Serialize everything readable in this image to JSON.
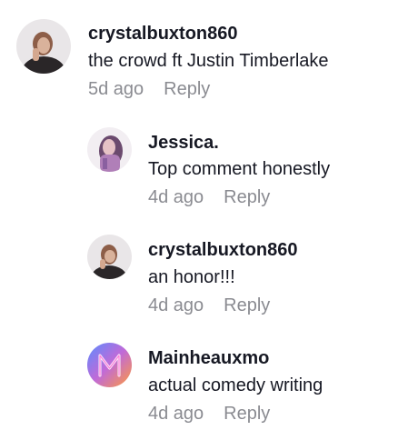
{
  "comment": {
    "username": "crystalbuxton860",
    "text": "the crowd ft Justin Timberlake",
    "time": "5d ago",
    "reply_label": "Reply"
  },
  "replies": [
    {
      "username": "Jessica.",
      "text": "Top comment honestly",
      "time": "4d ago",
      "reply_label": "Reply"
    },
    {
      "username": "crystalbuxton860",
      "text": "an honor!!!",
      "time": "4d ago",
      "reply_label": "Reply"
    },
    {
      "username": "Mainheauxmo",
      "text": "actual comedy writing",
      "time": "4d ago",
      "reply_label": "Reply"
    }
  ],
  "colors": {
    "text_primary": "#161823",
    "text_secondary": "#8a8b91"
  }
}
